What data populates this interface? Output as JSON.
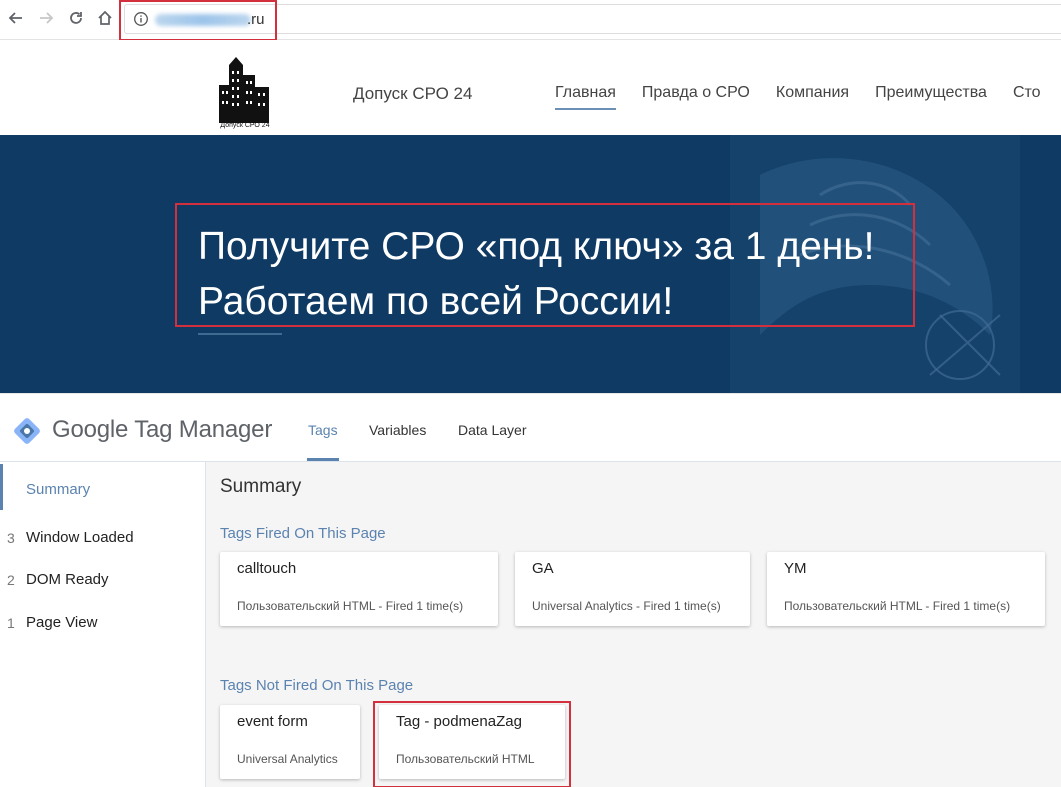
{
  "browser": {
    "url_visible": ".ru",
    "back_icon": "arrow-left-icon",
    "forward_icon": "arrow-right-icon",
    "reload_icon": "reload-icon",
    "home_icon": "home-icon",
    "info_icon": "info-icon"
  },
  "site": {
    "logo_caption": "Допуск СРО 24",
    "brand": "Допуск СРО 24",
    "menu": [
      {
        "label": "Главная",
        "active": true
      },
      {
        "label": "Правда о СРО",
        "active": false
      },
      {
        "label": "Компания",
        "active": false
      },
      {
        "label": "Преимущества",
        "active": false
      },
      {
        "label": "Сто",
        "active": false
      }
    ],
    "hero": {
      "line1": "Получите СРО «под ключ» за 1 день!",
      "line2": "Работаем по всей России!"
    },
    "colors": {
      "hero_bg": "#0f3a63",
      "highlight": "#d32f3c"
    }
  },
  "gtm": {
    "title": "Google Tag Manager",
    "tabs": [
      {
        "label": "Tags",
        "active": true
      },
      {
        "label": "Variables",
        "active": false
      },
      {
        "label": "Data Layer",
        "active": false
      }
    ],
    "sidebar": {
      "summary": "Summary",
      "events": [
        {
          "num": "3",
          "label": "Window Loaded"
        },
        {
          "num": "2",
          "label": "DOM Ready"
        },
        {
          "num": "1",
          "label": "Page View"
        }
      ]
    },
    "main": {
      "title": "Summary",
      "fired_title": "Tags Fired On This Page",
      "fired": [
        {
          "name": "calltouch",
          "desc": "Пользовательский HTML - Fired 1 time(s)"
        },
        {
          "name": "GA",
          "desc": "Universal Analytics - Fired 1 time(s)"
        },
        {
          "name": "YM",
          "desc": "Пользовательский HTML - Fired 1 time(s)"
        }
      ],
      "not_fired_title": "Tags Not Fired On This Page",
      "not_fired": [
        {
          "name": "event form",
          "desc": "Universal Analytics"
        },
        {
          "name": "Tag - podmenaZag",
          "desc": "Пользовательский HTML"
        }
      ]
    },
    "colors": {
      "accent": "#5b83b0"
    }
  }
}
